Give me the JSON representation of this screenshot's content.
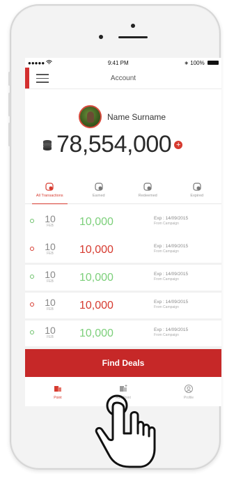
{
  "status_bar": {
    "carrier": "●●●●● ",
    "time": "9:41 PM",
    "battery": "100%"
  },
  "header": {
    "title": "Account"
  },
  "profile": {
    "name": "Name Surname",
    "points": "78,554,000",
    "add_label": "+"
  },
  "tabs": [
    {
      "label": "All Transactions",
      "active": true
    },
    {
      "label": "Earned",
      "active": false
    },
    {
      "label": "Redeemed",
      "active": false
    },
    {
      "label": "Expired",
      "active": false
    }
  ],
  "transactions": [
    {
      "day": "10",
      "month": "FEB",
      "amount": "10,000",
      "type": "earned",
      "exp": "Exp : 14/09/2015",
      "source": "From Campaign"
    },
    {
      "day": "10",
      "month": "FEB",
      "amount": "10,000",
      "type": "redeemed",
      "exp": "Exp : 14/09/2015",
      "source": "From Campaign"
    },
    {
      "day": "10",
      "month": "FEB",
      "amount": "10,000",
      "type": "earned",
      "exp": "Exp : 14/09/2015",
      "source": "From Campaign"
    },
    {
      "day": "10",
      "month": "FEB",
      "amount": "10,000",
      "type": "redeemed",
      "exp": "Exp : 14/09/2015",
      "source": "From Campaign"
    },
    {
      "day": "10",
      "month": "FEB",
      "amount": "10,000",
      "type": "earned",
      "exp": "Exp : 14/09/2015",
      "source": "From Campaign"
    }
  ],
  "cta": {
    "label": "Find Deals"
  },
  "bottom_nav": [
    {
      "label": "Point",
      "icon": "point-icon",
      "active": true
    },
    {
      "label": "Add Point",
      "icon": "add-point-icon",
      "active": false
    },
    {
      "label": "Profile",
      "icon": "profile-icon",
      "active": false
    }
  ],
  "colors": {
    "brand": "#c62828",
    "accent": "#d63a2f",
    "earned": "#7ccf7a"
  }
}
